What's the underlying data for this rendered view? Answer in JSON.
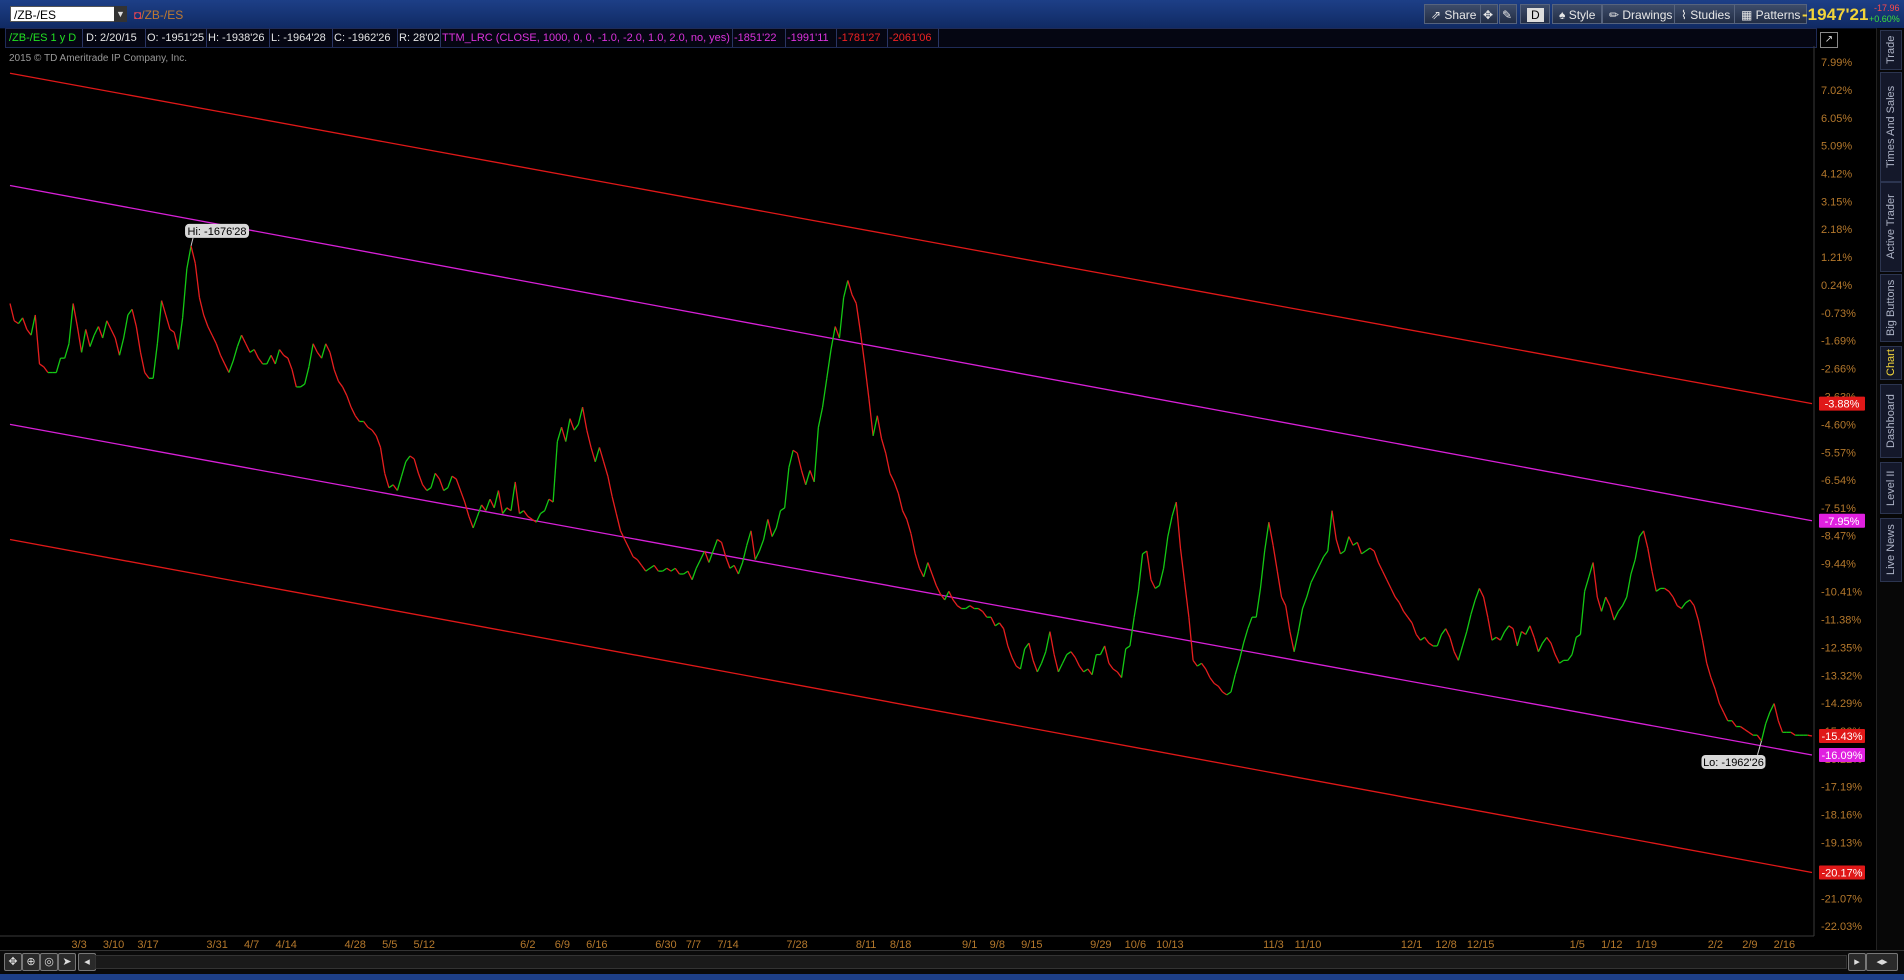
{
  "window": {
    "symbol": "/ZB-/ES",
    "symbol_label": "/ZB-/ES",
    "last_price": "-1947'21",
    "change_1": "-17.96",
    "change_2": "+0.60%"
  },
  "toolbar": {
    "share": "Share",
    "style": "Style",
    "drawings": "Drawings",
    "studies": "Studies",
    "patterns": "Patterns",
    "aggregation": "D"
  },
  "infobar": {
    "period": "/ZB-/ES 1 y D",
    "date": "D: 2/20/15",
    "open": "O: -1951'25",
    "high": "H: -1938'26",
    "low": "L: -1964'28",
    "close": "C: -1962'26",
    "range": "R: 28'02",
    "study": "TTM_LRC (CLOSE, 1000, 0, 0, -1.0, -2.0, 1.0, 2.0, no, yes)",
    "study_v1": "-1851'22",
    "study_v2": "-1991'11",
    "study_v3": "-1781'27",
    "study_v4": "-2061'06"
  },
  "copyright": "2015 © TD Ameritrade IP Company, Inc.",
  "side_tabs": [
    "Trade",
    "Times And Sales",
    "Active Trader",
    "Big Buttons",
    "Chart",
    "Dashboard",
    "Level II",
    "Live News"
  ],
  "colors": {
    "up": "#14c814",
    "down": "#e61e1e",
    "outer_band": "#e01818",
    "inner_band": "#d820d8",
    "axis_text": "#b4782c",
    "bg": "#000000"
  },
  "chart_data": {
    "type": "line",
    "title": "/ZB-/ES",
    "y_axis": {
      "unit": "% change",
      "range": [
        -22.03,
        7.99
      ],
      "ticks": [
        7.99,
        7.02,
        6.05,
        5.09,
        4.12,
        3.15,
        2.18,
        1.21,
        0.24,
        -0.73,
        -1.69,
        -2.66,
        -3.63,
        -4.6,
        -5.57,
        -6.54,
        -7.51,
        -8.47,
        -9.44,
        -10.41,
        -11.38,
        -12.35,
        -13.32,
        -14.29,
        -15.26,
        -16.22,
        -17.19,
        -18.16,
        -19.13,
        -20.1,
        -21.07,
        -22.03
      ],
      "tick_labels": [
        "7.99%",
        "7.02%",
        "6.05%",
        "5.09%",
        "4.12%",
        "3.15%",
        "2.18%",
        "1.21%",
        "0.24%",
        "-0.73%",
        "-1.69%",
        "-2.66%",
        "-3.63%",
        "-4.60%",
        "-5.57%",
        "-6.54%",
        "-7.51%",
        "-8.47%",
        "-9.44%",
        "-10.41%",
        "-11.38%",
        "-12.35%",
        "-13.32%",
        "-14.29%",
        "-15.26%",
        "-16.22%",
        "-17.19%",
        "-18.16%",
        "-19.13%",
        "-20.1%",
        "-21.07%",
        "-22.03%"
      ]
    },
    "x_ticks": [
      {
        "label": "3/3",
        "i": 10
      },
      {
        "label": "3/10",
        "i": 15
      },
      {
        "label": "3/17",
        "i": 20
      },
      {
        "label": "3/31",
        "i": 30
      },
      {
        "label": "4/7",
        "i": 35
      },
      {
        "label": "4/14",
        "i": 40
      },
      {
        "label": "4/28",
        "i": 50
      },
      {
        "label": "5/5",
        "i": 55
      },
      {
        "label": "5/12",
        "i": 60
      },
      {
        "label": "6/2",
        "i": 75
      },
      {
        "label": "6/9",
        "i": 80
      },
      {
        "label": "6/16",
        "i": 85
      },
      {
        "label": "6/30",
        "i": 95
      },
      {
        "label": "7/7",
        "i": 99
      },
      {
        "label": "7/14",
        "i": 104
      },
      {
        "label": "7/28",
        "i": 114
      },
      {
        "label": "8/11",
        "i": 124
      },
      {
        "label": "8/18",
        "i": 129
      },
      {
        "label": "9/1",
        "i": 139
      },
      {
        "label": "9/8",
        "i": 143
      },
      {
        "label": "9/15",
        "i": 148
      },
      {
        "label": "9/29",
        "i": 158
      },
      {
        "label": "10/6",
        "i": 163
      },
      {
        "label": "10/13",
        "i": 168
      },
      {
        "label": "11/3",
        "i": 183
      },
      {
        "label": "11/10",
        "i": 188
      },
      {
        "label": "12/1",
        "i": 203
      },
      {
        "label": "12/8",
        "i": 208
      },
      {
        "label": "12/15",
        "i": 213
      },
      {
        "label": "1/5",
        "i": 227
      },
      {
        "label": "1/12",
        "i": 232
      },
      {
        "label": "1/19",
        "i": 237
      },
      {
        "label": "2/2",
        "i": 247
      },
      {
        "label": "2/9",
        "i": 252
      },
      {
        "label": "2/16",
        "i": 257
      }
    ],
    "series": [
      {
        "name": "/ZB-/ES",
        "values": [
          -0.4,
          -1.0,
          -1.1,
          -0.9,
          -1.3,
          -1.5,
          -0.8,
          -2.5,
          -2.6,
          -2.8,
          -2.8,
          -2.8,
          -2.3,
          -2.3,
          -1.8,
          -0.4,
          -1.2,
          -2.1,
          -1.3,
          -1.9,
          -1.5,
          -1.2,
          -1.6,
          -1.0,
          -1.3,
          -1.6,
          -2.2,
          -1.6,
          -0.8,
          -0.6,
          -1.2,
          -2.1,
          -2.8,
          -3.0,
          -3.0,
          -1.8,
          -0.3,
          -0.8,
          -1.3,
          -1.4,
          -2.0,
          -0.9,
          0.8,
          1.6,
          1.0,
          -0.2,
          -0.8,
          -1.2,
          -1.5,
          -1.8,
          -2.2,
          -2.5,
          -2.8,
          -2.4,
          -1.9,
          -1.5,
          -1.8,
          -2.1,
          -2.0,
          -2.3,
          -2.5,
          -2.5,
          -2.2,
          -2.5,
          -2.0,
          -2.2,
          -2.3,
          -2.7,
          -3.3,
          -3.3,
          -3.2,
          -2.6,
          -1.8,
          -2.1,
          -2.3,
          -1.8,
          -2.1,
          -2.7,
          -3.1,
          -3.3,
          -3.6,
          -4.0,
          -4.3,
          -4.5,
          -4.5,
          -4.7,
          -4.8,
          -5.0,
          -5.4,
          -6.3,
          -6.8,
          -6.7,
          -6.9,
          -6.4,
          -5.9,
          -5.7,
          -5.8,
          -6.3,
          -6.7,
          -6.9,
          -6.8,
          -6.3,
          -6.5,
          -6.9,
          -6.8,
          -6.4,
          -6.5,
          -6.9,
          -7.3,
          -7.8,
          -8.2,
          -7.8,
          -7.4,
          -7.6,
          -7.2,
          -7.5,
          -6.9,
          -7.7,
          -7.5,
          -7.6,
          -6.6,
          -7.7,
          -7.6,
          -7.8,
          -7.9,
          -8.0,
          -7.7,
          -7.6,
          -7.2,
          -7.3,
          -5.2,
          -4.7,
          -5.2,
          -4.4,
          -4.8,
          -4.6,
          -4.0,
          -4.8,
          -5.4,
          -5.9,
          -5.4,
          -5.9,
          -6.4,
          -7.1,
          -7.7,
          -8.3,
          -8.6,
          -8.9,
          -9.2,
          -9.3,
          -9.5,
          -9.7,
          -9.6,
          -9.5,
          -9.7,
          -9.7,
          -9.6,
          -9.7,
          -9.6,
          -9.8,
          -9.8,
          -9.7,
          -10.0,
          -9.6,
          -9.3,
          -9.0,
          -9.4,
          -9.0,
          -8.6,
          -8.7,
          -9.2,
          -9.6,
          -9.5,
          -9.8,
          -9.4,
          -8.8,
          -8.3,
          -9.3,
          -9.0,
          -8.6,
          -7.9,
          -8.5,
          -8.2,
          -7.6,
          -7.5,
          -6.1,
          -5.5,
          -5.6,
          -6.2,
          -6.7,
          -6.2,
          -6.6,
          -4.7,
          -4.0,
          -3.0,
          -2.0,
          -1.2,
          -1.6,
          -0.2,
          0.4,
          -0.1,
          -0.4,
          -1.4,
          -2.5,
          -3.7,
          -5.0,
          -4.3,
          -5.1,
          -5.6,
          -6.3,
          -6.6,
          -7.0,
          -7.6,
          -7.9,
          -8.4,
          -9.1,
          -9.6,
          -9.9,
          -9.4,
          -9.8,
          -10.2,
          -10.5,
          -10.7,
          -10.4,
          -10.7,
          -10.9,
          -11.0,
          -11.0,
          -10.9,
          -11.0,
          -11.0,
          -11.1,
          -11.3,
          -11.3,
          -11.6,
          -11.5,
          -11.7,
          -12.3,
          -12.7,
          -13.0,
          -13.1,
          -12.4,
          -12.2,
          -12.8,
          -13.2,
          -12.9,
          -12.5,
          -11.8,
          -12.6,
          -13.2,
          -12.9,
          -12.6,
          -12.5,
          -12.7,
          -13.0,
          -13.2,
          -13.1,
          -13.3,
          -12.6,
          -12.6,
          -12.3,
          -12.9,
          -13.1,
          -13.2,
          -13.4,
          -12.4,
          -12.3,
          -11.3,
          -10.4,
          -9.1,
          -9.0,
          -10.0,
          -10.3,
          -10.2,
          -9.6,
          -8.5,
          -7.8,
          -7.3,
          -8.9,
          -10.1,
          -11.3,
          -12.8,
          -13.0,
          -12.9,
          -13.1,
          -13.4,
          -13.6,
          -13.7,
          -13.9,
          -14.0,
          -13.9,
          -13.3,
          -12.8,
          -12.2,
          -11.7,
          -11.3,
          -11.3,
          -10.3,
          -9.0,
          -8.0,
          -8.8,
          -9.7,
          -10.6,
          -10.9,
          -11.8,
          -12.5,
          -11.8,
          -11.0,
          -10.6,
          -10.1,
          -9.8,
          -9.5,
          -9.2,
          -9.0,
          -7.6,
          -8.6,
          -9.1,
          -9.0,
          -8.5,
          -8.8,
          -8.7,
          -9.1,
          -9.0,
          -8.9,
          -9.0,
          -9.4,
          -9.7,
          -10.0,
          -10.3,
          -10.6,
          -10.8,
          -11.1,
          -11.3,
          -11.5,
          -11.9,
          -12.1,
          -12.0,
          -12.2,
          -12.3,
          -12.3,
          -11.9,
          -11.7,
          -12.0,
          -12.5,
          -12.8,
          -12.3,
          -11.8,
          -11.2,
          -10.7,
          -10.3,
          -10.6,
          -11.3,
          -12.1,
          -12.0,
          -12.1,
          -11.8,
          -11.6,
          -11.7,
          -12.3,
          -11.8,
          -11.9,
          -11.6,
          -12.0,
          -12.5,
          -12.2,
          -12.0,
          -12.2,
          -12.6,
          -12.9,
          -12.8,
          -12.8,
          -12.6,
          -12.0,
          -11.9,
          -10.4,
          -9.9,
          -9.4,
          -10.6,
          -11.1,
          -10.6,
          -10.9,
          -11.4,
          -11.1,
          -10.9,
          -10.6,
          -9.8,
          -9.3,
          -8.5,
          -8.3,
          -8.9,
          -9.7,
          -10.4,
          -10.3,
          -10.3,
          -10.4,
          -10.6,
          -10.9,
          -11.0,
          -10.8,
          -10.7,
          -10.9,
          -11.4,
          -12.1,
          -12.9,
          -13.4,
          -13.8,
          -14.3,
          -14.6,
          -14.9,
          -14.9,
          -15.1,
          -15.1,
          -15.2,
          -15.3,
          -15.4,
          -15.4,
          -15.6,
          -15.0,
          -14.6,
          -14.3,
          -14.9,
          -15.3,
          -15.3,
          -15.3,
          -15.4,
          -15.4,
          -15.4,
          -15.4,
          -15.43
        ]
      }
    ],
    "bands": [
      {
        "name": "upper_outer",
        "start": 7.6,
        "end": -3.88,
        "label": "-3.88%"
      },
      {
        "name": "upper_inner",
        "start": 3.7,
        "end": -7.95,
        "label": "-7.95%"
      },
      {
        "name": "lower_inner",
        "start": -4.6,
        "end": -16.09,
        "label": "-16.09%"
      },
      {
        "name": "lower_outer",
        "start": -8.6,
        "end": -20.17,
        "label": "-20.17%"
      }
    ],
    "last_label": "-15.43%",
    "hi_label": "Hi: -1676'28",
    "lo_label": "Lo: -1962'26"
  }
}
